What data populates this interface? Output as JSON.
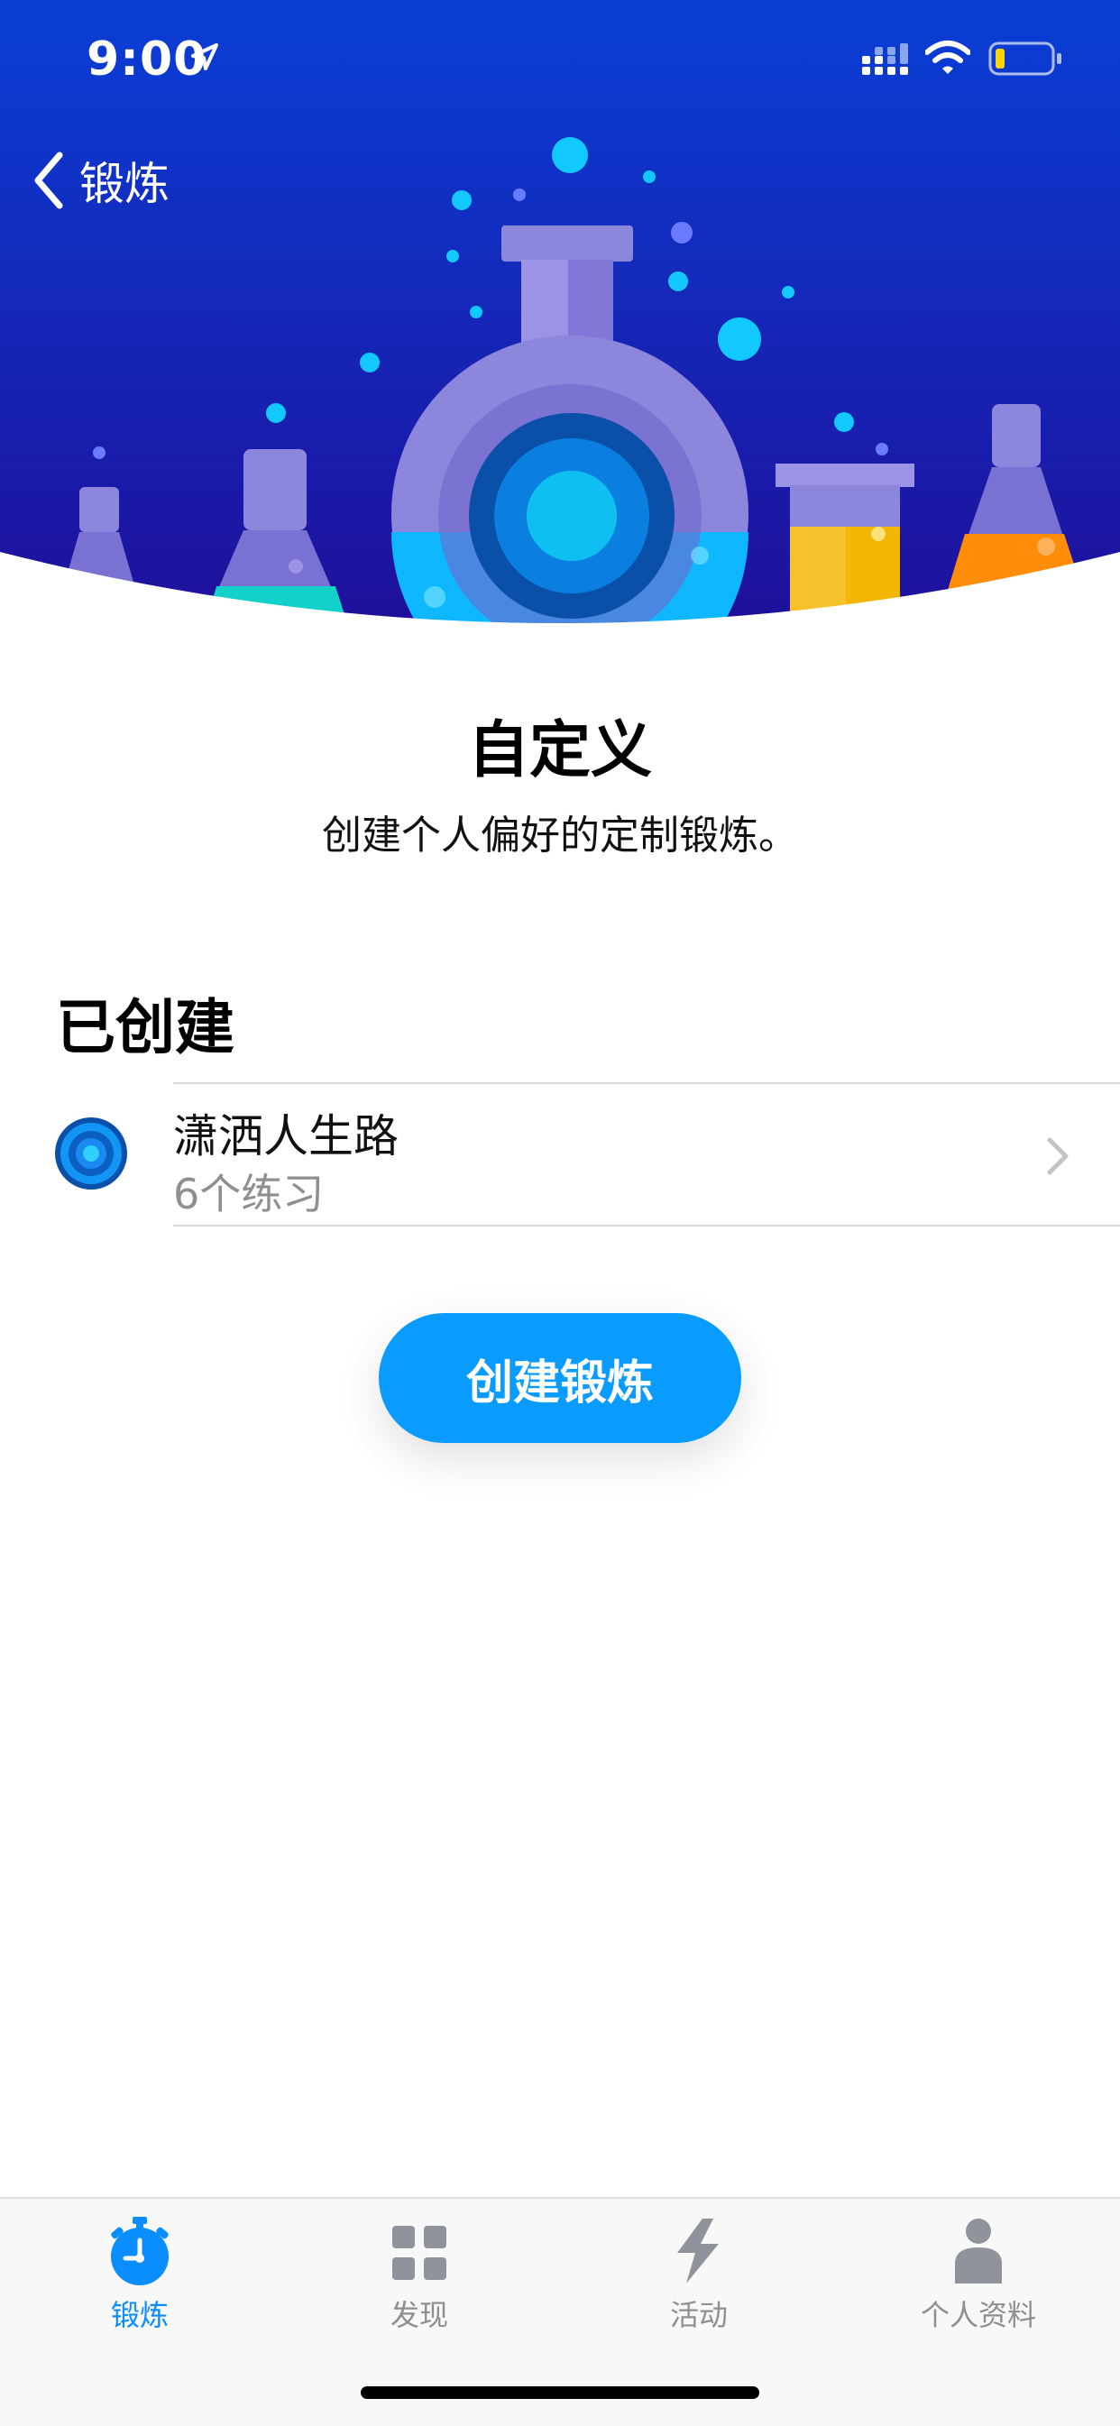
{
  "status_bar": {
    "time": "9:00"
  },
  "nav": {
    "back_label": "锻炼"
  },
  "header": {
    "title": "自定义",
    "subtitle": "创建个人偏好的定制锻炼。"
  },
  "section": {
    "heading": "已创建"
  },
  "workouts": [
    {
      "title": "潇洒人生路",
      "subtitle": "6个练习"
    }
  ],
  "create_button": {
    "label": "创建锻炼"
  },
  "tab_bar": {
    "tabs": [
      {
        "label": "锻炼",
        "icon": "stopwatch-icon",
        "active": true
      },
      {
        "label": "发现",
        "icon": "grid-icon",
        "active": false
      },
      {
        "label": "活动",
        "icon": "bolt-icon",
        "active": false
      },
      {
        "label": "个人资料",
        "icon": "person-icon",
        "active": false
      }
    ]
  },
  "colors": {
    "accent": "#0a9bff",
    "tab_active": "#0a8dff",
    "hero_top": "#0a3fd6",
    "hero_bottom": "#1f0f9a"
  }
}
